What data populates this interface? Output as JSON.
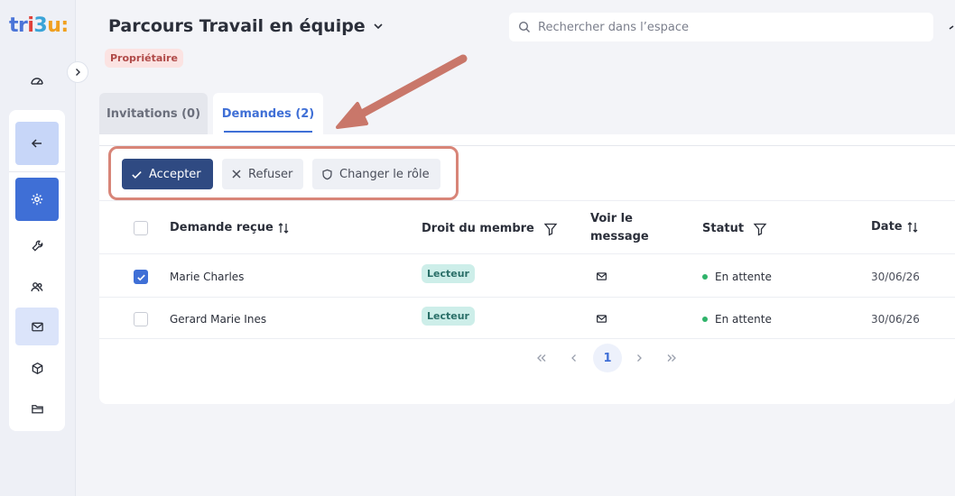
{
  "app": {
    "logo_text": "tri3u:",
    "colors": {
      "primary": "#3f6fd6",
      "accept": "#2f4a82",
      "highlight": "#d88578",
      "badge_bg": "#fbe3e2",
      "pill_bg": "#cdeee9",
      "status": "#2fb36a"
    }
  },
  "sidebar": {
    "items": [
      {
        "icon": "dashboard-icon"
      },
      {
        "icon": "arrow-left-icon"
      },
      {
        "icon": "gear-icon"
      },
      {
        "icon": "wrench-icon"
      },
      {
        "icon": "users-icon"
      },
      {
        "icon": "mail-icon"
      },
      {
        "icon": "cube-icon"
      },
      {
        "icon": "folder-icon"
      }
    ]
  },
  "header": {
    "title": "Parcours Travail en équipe",
    "role_badge": "Propriétaire",
    "search_placeholder": "Rechercher dans l’espace"
  },
  "tabs": [
    {
      "label": "Invitations (0)",
      "active": false
    },
    {
      "label": "Demandes (2)",
      "active": true
    }
  ],
  "toolbar": {
    "accept_label": "Accepter",
    "refuse_label": "Refuser",
    "change_role_label": "Changer le rôle"
  },
  "table": {
    "columns": {
      "request": "Demande reçue",
      "member_right": "Droit du membre",
      "message_line1": "Voir le",
      "message_line2": "message",
      "status": "Statut",
      "date": "Date"
    },
    "rows": [
      {
        "checked": true,
        "name": "Marie Charles",
        "right": "Lecteur",
        "status": "En attente",
        "date": "30/06/26"
      },
      {
        "checked": false,
        "name": "Gerard Marie Ines",
        "right": "Lecteur",
        "status": "En attente",
        "date": "30/06/26"
      }
    ]
  },
  "pagination": {
    "current": "1"
  }
}
